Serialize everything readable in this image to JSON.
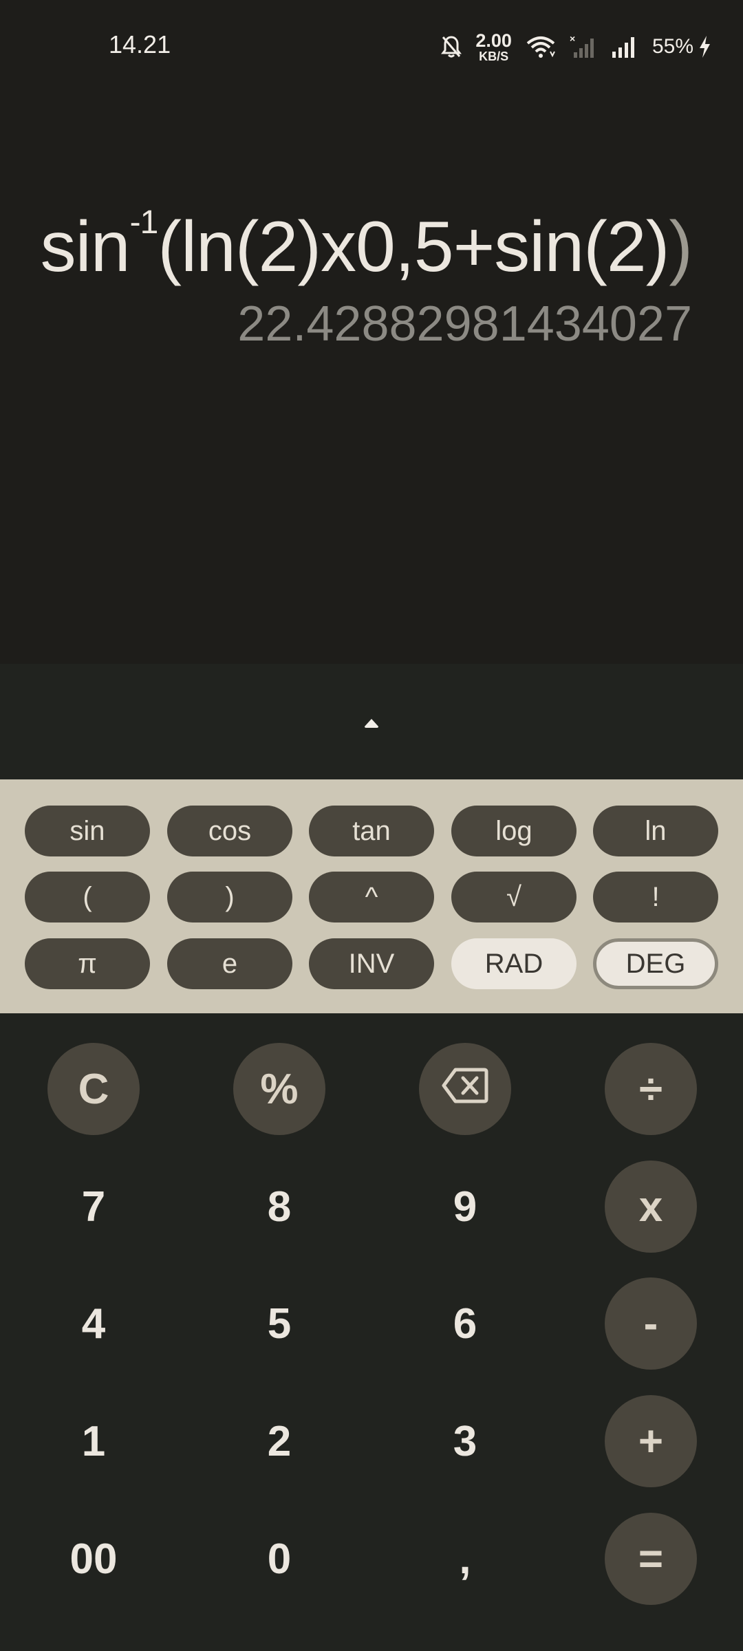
{
  "status_bar": {
    "time": "14.21",
    "net_rate_value": "2.00",
    "net_rate_unit": "KB/S",
    "battery": "55%"
  },
  "display": {
    "expression_fn": "sin",
    "expression_sup": "-1",
    "expression_body": "(ln(2)x0,5+sin(2)",
    "expression_tail": ")",
    "result": "22.42882981434027"
  },
  "scientific": {
    "row1": [
      "sin",
      "cos",
      "tan",
      "log",
      "ln"
    ],
    "row2": [
      "(",
      ")",
      "^",
      "√",
      "!"
    ],
    "row3": [
      "π",
      "e",
      "INV",
      "RAD",
      "DEG"
    ],
    "active_mode": "DEG"
  },
  "keypad": {
    "clear": "C",
    "percent": "%",
    "divide": "÷",
    "multiply": "x",
    "minus": "-",
    "plus": "+",
    "equals": "=",
    "seven": "7",
    "eight": "8",
    "nine": "9",
    "four": "4",
    "five": "5",
    "six": "6",
    "one": "1",
    "two": "2",
    "three": "3",
    "double_zero": "00",
    "zero": "0",
    "comma": ","
  },
  "colors": {
    "background": "#1e1d1a",
    "keypad_bg": "#21231f",
    "sci_panel_bg": "#cdc7b6",
    "key_dark": "#4a463d",
    "text_light": "#ece7df",
    "result_gray": "#8c8a84"
  }
}
